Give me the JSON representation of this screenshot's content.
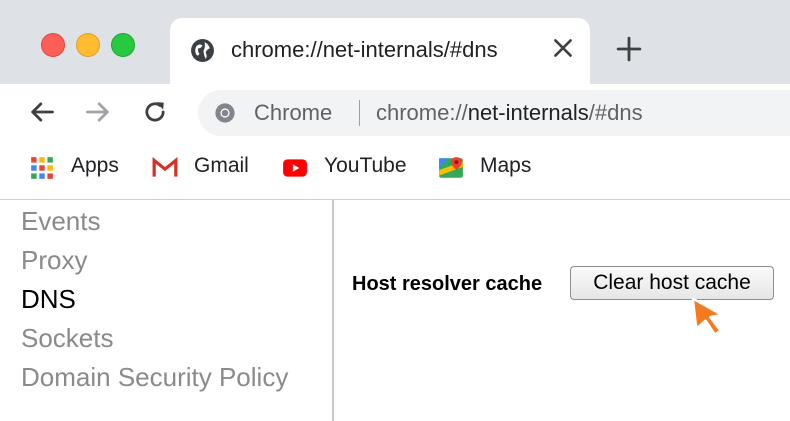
{
  "tab": {
    "title": "chrome://net-internals/#dns",
    "close_icon": "close-icon",
    "new_tab_icon": "plus-icon"
  },
  "window_controls": {
    "colors": {
      "close": "#fd5f57",
      "minimize": "#febc2e",
      "maximize": "#28c840"
    }
  },
  "toolbar": {
    "back_icon": "arrow-left-icon",
    "forward_icon": "arrow-right-icon",
    "reload_icon": "reload-icon"
  },
  "omnibox": {
    "site_label": "Chrome",
    "url_scheme": "chrome://",
    "url_host": "net-internals",
    "url_path": "/#dns"
  },
  "bookmarks": [
    {
      "label": "Apps",
      "icon": "apps-grid-icon"
    },
    {
      "label": "Gmail",
      "icon": "gmail-icon"
    },
    {
      "label": "YouTube",
      "icon": "youtube-icon"
    },
    {
      "label": "Maps",
      "icon": "maps-icon"
    }
  ],
  "sidebar": {
    "items": [
      {
        "label": "Events",
        "active": false
      },
      {
        "label": "Proxy",
        "active": false
      },
      {
        "label": "DNS",
        "active": true
      },
      {
        "label": "Sockets",
        "active": false
      },
      {
        "label": "Domain Security Policy",
        "active": false
      }
    ]
  },
  "main": {
    "host_resolver_label": "Host resolver cache",
    "clear_button_label": "Clear host cache"
  },
  "colors": {
    "tab_strip": "#dee1e6",
    "omnibox_bg": "#f1f3f4",
    "cursor_accent": "#f47b20"
  }
}
